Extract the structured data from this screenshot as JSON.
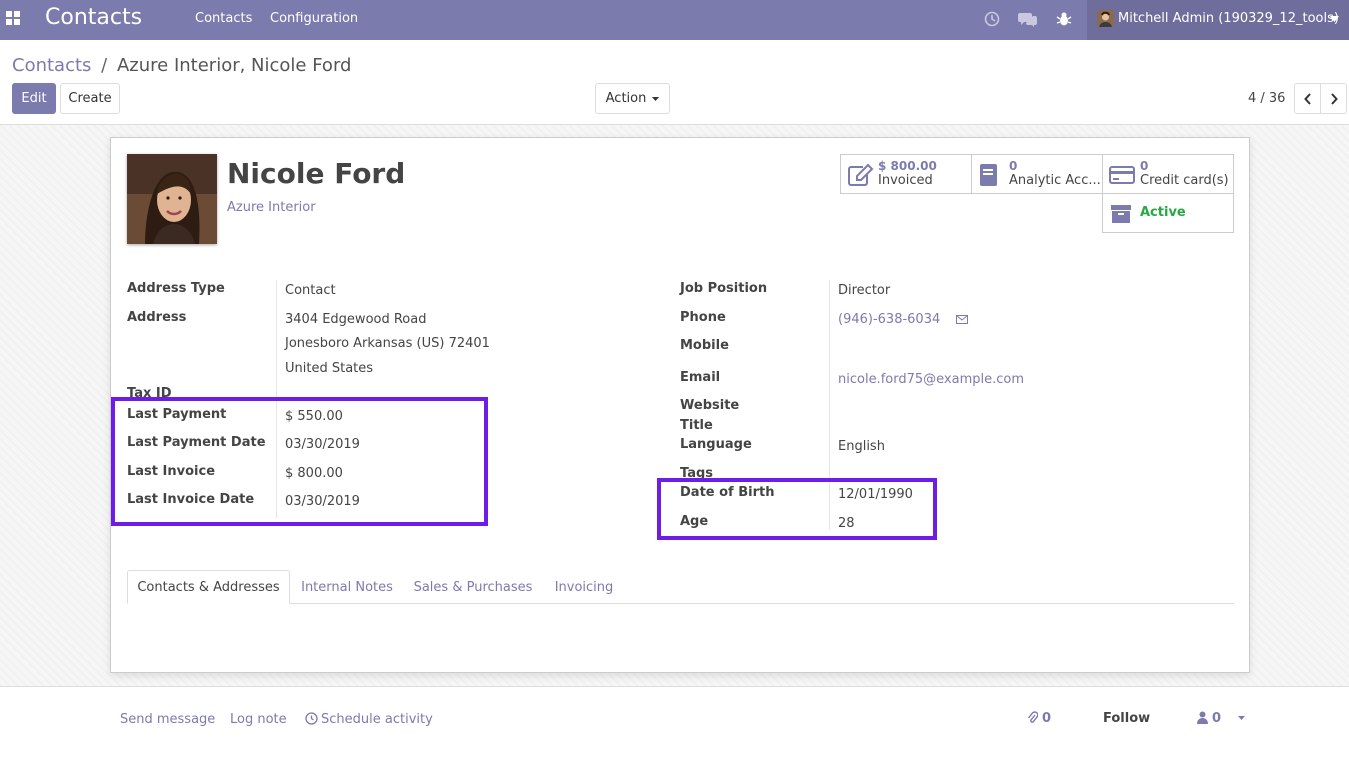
{
  "navbar": {
    "brand": "Contacts",
    "menu": [
      "Contacts",
      "Configuration"
    ],
    "user": "Mitchell Admin (190329_12_tools)"
  },
  "control": {
    "breadcrumb_root": "Contacts",
    "breadcrumb_sep": "/",
    "breadcrumb_current": "Azure Interior, Nicole Ford",
    "edit_label": "Edit",
    "create_label": "Create",
    "action_label": "Action",
    "pager": "4 / 36"
  },
  "partner": {
    "name": "Nicole Ford",
    "company": "Azure Interior"
  },
  "stats": {
    "invoiced_value": "$ 800.00",
    "invoiced_label": "Invoiced",
    "analytic_value": "0",
    "analytic_label": "Analytic Acc...",
    "cards_value": "0",
    "cards_label": "Credit card(s)",
    "active_label": "Active"
  },
  "left_fields": {
    "address_type_label": "Address Type",
    "address_type_value": "Contact",
    "address_label": "Address",
    "address_line1": "3404 Edgewood Road",
    "address_line2": "Jonesboro  Arkansas (US)  72401",
    "address_line3": "United States",
    "tax_id_label": "Tax ID",
    "last_payment_label": "Last Payment",
    "last_payment_value": "$ 550.00",
    "last_payment_date_label": "Last Payment Date",
    "last_payment_date_value": "03/30/2019",
    "last_invoice_label": "Last Invoice",
    "last_invoice_value": "$ 800.00",
    "last_invoice_date_label": "Last Invoice Date",
    "last_invoice_date_value": "03/30/2019"
  },
  "right_fields": {
    "job_position_label": "Job Position",
    "job_position_value": "Director",
    "phone_label": "Phone",
    "phone_value": "(946)-638-6034",
    "mobile_label": "Mobile",
    "email_label": "Email",
    "email_value": "nicole.ford75@example.com",
    "website_label": "Website",
    "title_label": "Title",
    "language_label": "Language",
    "language_value": "English",
    "tags_label": "Tags",
    "dob_label": "Date of Birth",
    "dob_value": "12/01/1990",
    "age_label": "Age",
    "age_value": "28"
  },
  "tabs": [
    "Contacts & Addresses",
    "Internal Notes",
    "Sales & Purchases",
    "Invoicing"
  ],
  "chatter": {
    "send_message": "Send message",
    "log_note": "Log note",
    "schedule_activity": "Schedule activity",
    "attachments_count": "0",
    "follow": "Follow",
    "followers_count": "0"
  },
  "colors": {
    "brand": "#7c7bad",
    "highlight": "#6f1de6",
    "active": "#28a745"
  }
}
